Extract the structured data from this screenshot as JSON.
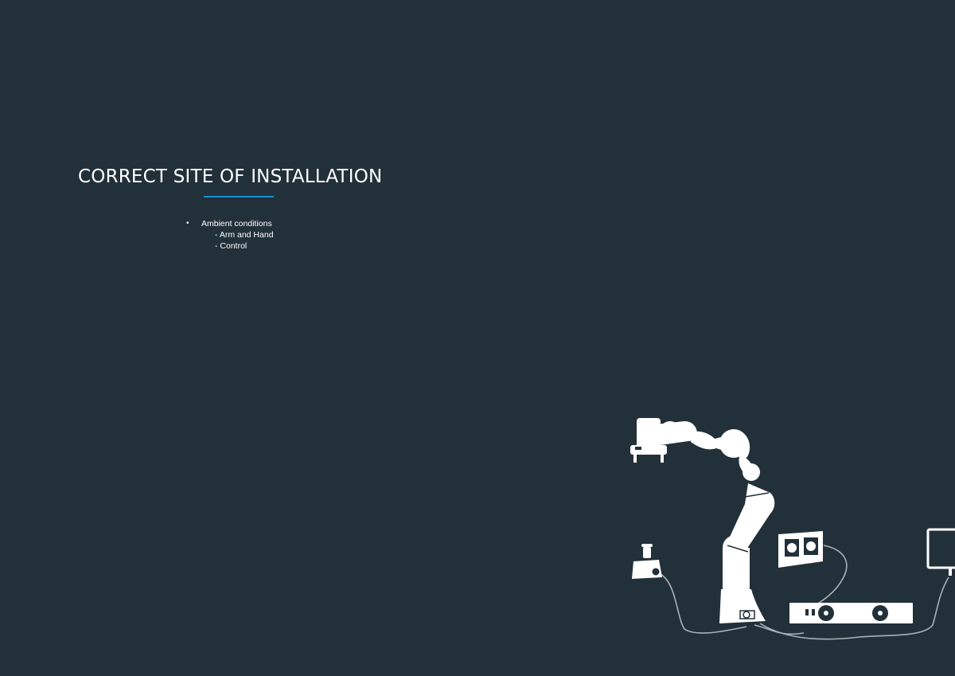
{
  "slide": {
    "title": "CORRECT SITE OF INSTALLATION",
    "bullets": [
      {
        "label": "Ambient conditions",
        "sub_items": [
          "- Arm and Hand",
          "- Control"
        ]
      }
    ]
  },
  "colors": {
    "background": "#22303a",
    "accent": "#1a8fd6",
    "text": "#ffffff"
  },
  "illustration": {
    "icon": "robot-arm-installation-icon"
  }
}
